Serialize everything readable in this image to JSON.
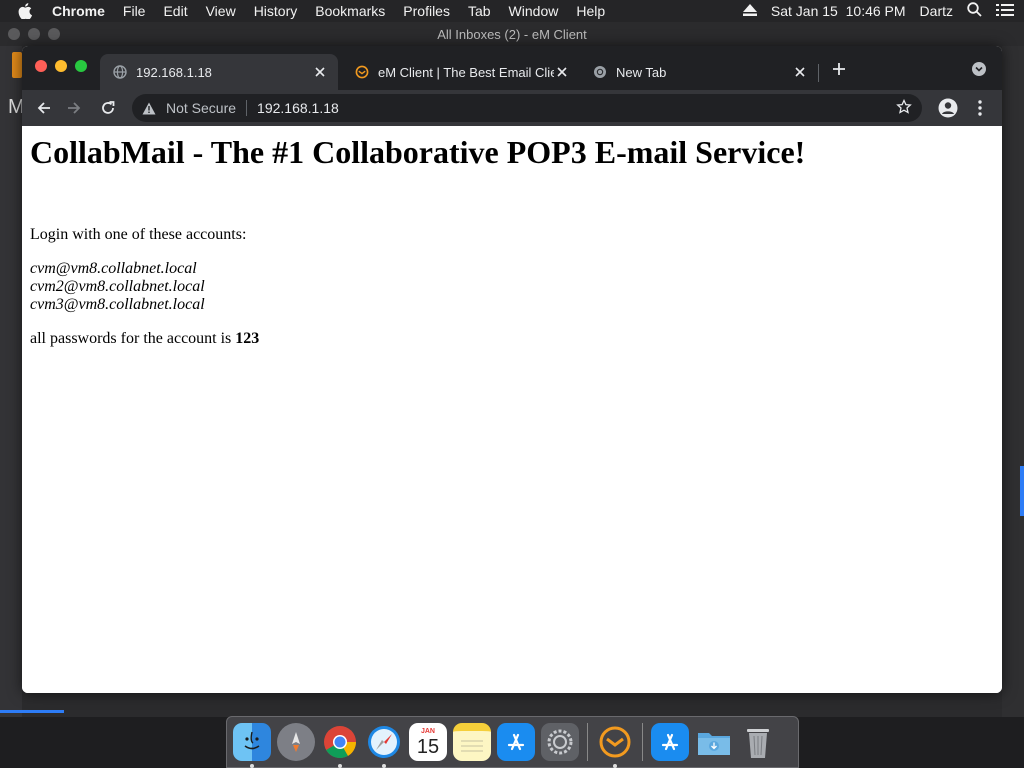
{
  "menubar": {
    "app_name": "Chrome",
    "items": [
      "File",
      "Edit",
      "View",
      "History",
      "Bookmarks",
      "Profiles",
      "Tab",
      "Window",
      "Help"
    ],
    "clock": "Sat Jan 15  10:46 PM",
    "user": "Dartz"
  },
  "background_window": {
    "title": "All Inboxes (2) - eM Client",
    "sidebar_letter": "M"
  },
  "browser": {
    "tabs": [
      {
        "title": "192.168.1.18",
        "icon": "globe-icon",
        "active": true
      },
      {
        "title": "eM Client | The Best Email Clie",
        "icon": "emclient-icon",
        "active": false
      },
      {
        "title": "New Tab",
        "icon": "chrome-icon",
        "active": false
      }
    ],
    "security_label": "Not Secure",
    "url": "192.168.1.18"
  },
  "page": {
    "heading": "CollabMail - The #1 Collaborative POP3 E-mail Service!",
    "intro": "Login with one of these accounts:",
    "accounts": [
      "cvm@vm8.collabnet.local",
      "cvm2@vm8.collabnet.local",
      "cvm3@vm8.collabnet.local"
    ],
    "password_text": "all passwords for the account is ",
    "password_value": "123"
  },
  "dock": {
    "apps": [
      "finder",
      "launchpad",
      "chrome",
      "safari",
      "calendar",
      "notes",
      "app-store",
      "system-preferences",
      "em-client",
      "app-store-alt",
      "downloads",
      "trash"
    ],
    "calendar_month": "JAN",
    "calendar_day": "15"
  },
  "colors": {
    "chrome_dark": "#202124",
    "chrome_tab_active": "#35363a",
    "traffic_red": "#ff5f57",
    "traffic_yellow": "#febc2e",
    "traffic_green": "#28c840"
  }
}
